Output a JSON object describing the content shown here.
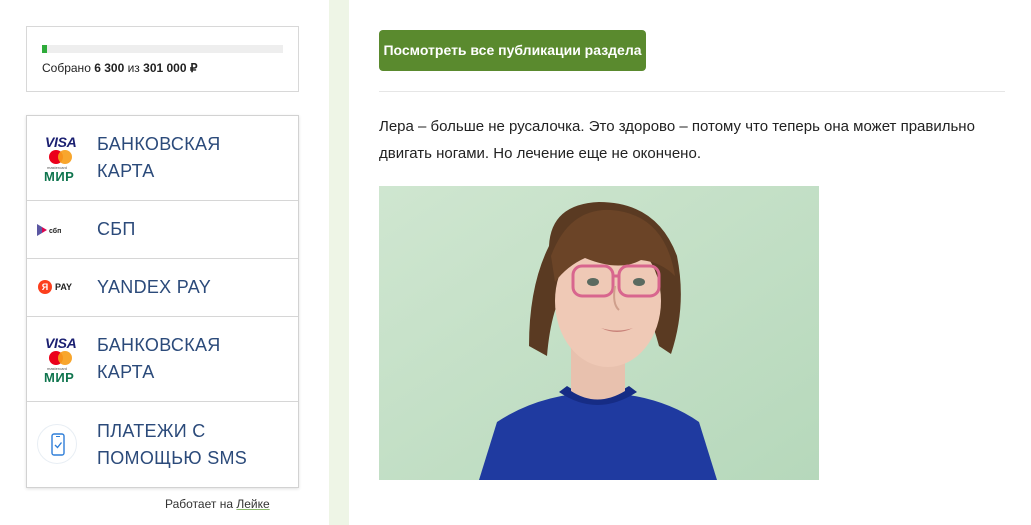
{
  "fundraising": {
    "progress_percent": 2.1,
    "label_prefix": "Собрано",
    "collected": "6 300",
    "separator": "из",
    "goal": "301 000 ₽"
  },
  "payment_methods": [
    {
      "label_line1": "БАНКОВСКАЯ",
      "label_line2": "КАРТА",
      "icon": "visa-mastercard-mir-icon"
    },
    {
      "label_line1": "СБП",
      "label_line2": "",
      "icon": "sbp-icon"
    },
    {
      "label_line1": "YANDEX PAY",
      "label_line2": "",
      "icon": "yandex-pay-icon"
    },
    {
      "label_line1": "БАНКОВСКАЯ",
      "label_line2": "КАРТА",
      "icon": "visa-mastercard-mir-icon"
    },
    {
      "label_line1": "ПЛАТЕЖИ С",
      "label_line2": "ПОМОЩЬЮ SMS",
      "icon": "sms-phone-icon"
    }
  ],
  "logos": {
    "visa": "VISA",
    "mastercard": "mastercard",
    "mir": "МИР",
    "sbp": "сбп",
    "yandex_letter": "Я",
    "pay": "PAY"
  },
  "powered_by": {
    "prefix": "Работает на",
    "link": "Лейке"
  },
  "main": {
    "button_label": "Посмотреть все публикации раздела",
    "paragraph": "Лера – больше не русалочка. Это здорово – потому что теперь она может правильно двигать ногами. Но лечение еще не окончено."
  },
  "colors": {
    "accent_green": "#5a8a2e",
    "progress_green": "#2eab3a",
    "label_blue": "#2b4a7a",
    "sidebar_strip": "#eef5e6"
  }
}
